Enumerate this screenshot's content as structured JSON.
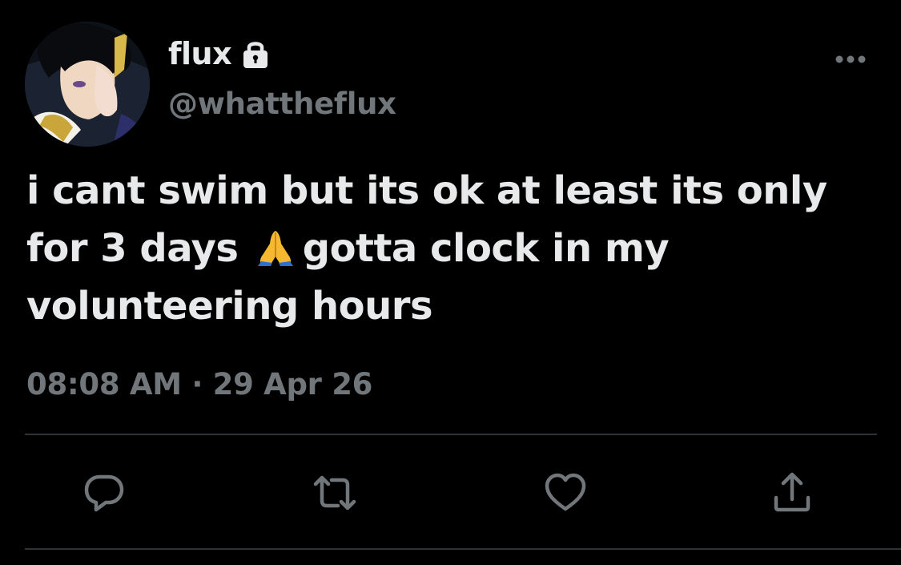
{
  "tweet": {
    "display_name": "flux",
    "handle": "@whattheflux",
    "text_part1": "i cant swim but its ok at least its only for 3 days",
    "text_part2": "gotta clock in my volunteering hours",
    "emoji": "folded-hands",
    "time": "08:08 AM",
    "separator": "·",
    "date": "29 Apr 26"
  },
  "icons": {
    "protected": "lock-icon",
    "more": "more-icon",
    "reply": "reply-icon",
    "retweet": "retweet-icon",
    "like": "heart-icon",
    "share": "share-icon"
  },
  "colors": {
    "background": "#000000",
    "primary_text": "#e7e9ea",
    "secondary_text": "#71767b",
    "divider": "#2f3336"
  }
}
